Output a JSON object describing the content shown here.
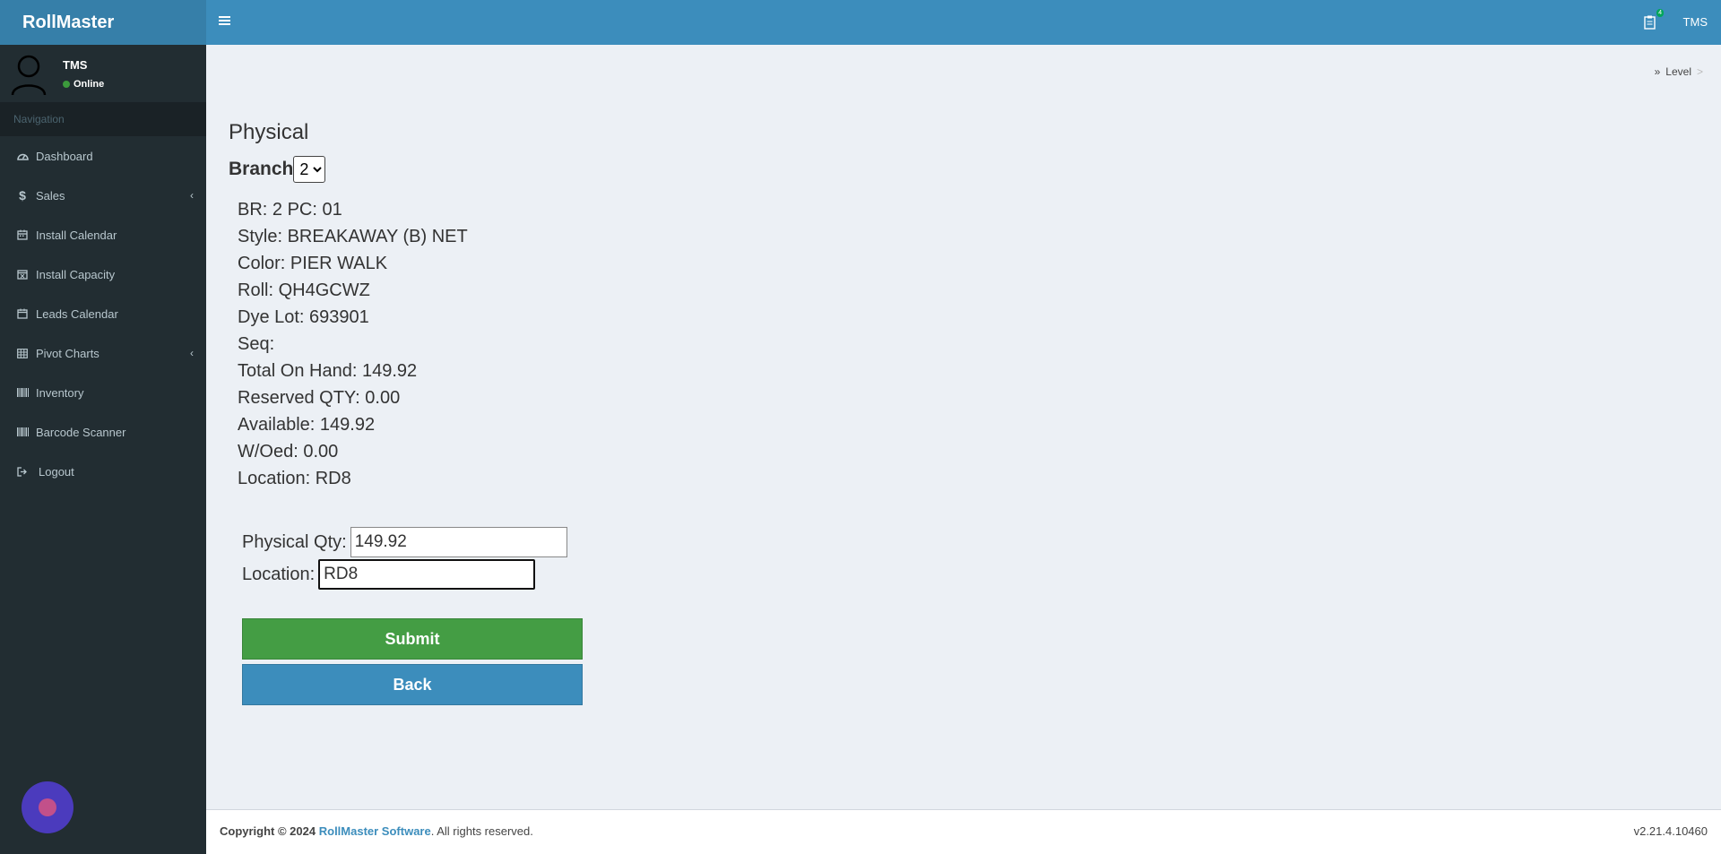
{
  "app": {
    "title": "RollMaster"
  },
  "user": {
    "name": "TMS",
    "status": "Online"
  },
  "nav": {
    "header": "Navigation",
    "items": [
      {
        "label": "Dashboard",
        "icon": "dashboard-icon"
      },
      {
        "label": "Sales",
        "icon": "dollar-icon"
      },
      {
        "label": "Install Calendar",
        "icon": "calendar-icon"
      },
      {
        "label": "Install Capacity",
        "icon": "calendar-x-icon"
      },
      {
        "label": "Leads Calendar",
        "icon": "calendar-icon"
      },
      {
        "label": "Pivot Charts",
        "icon": "table-icon"
      },
      {
        "label": "Inventory",
        "icon": "barcode-icon"
      },
      {
        "label": "Barcode Scanner",
        "icon": "barcode-icon"
      },
      {
        "label": "Logout",
        "icon": "sign-out-icon"
      }
    ]
  },
  "header": {
    "user": "TMS",
    "notification_count": "4"
  },
  "breadcrumb": {
    "item": "Level",
    "separator": ">"
  },
  "page": {
    "title": "Physical",
    "branch_label": "Branch",
    "branch_value": "2"
  },
  "details": [
    "BR: 2 PC: 01",
    "Style: BREAKAWAY (B) NET",
    "Color: PIER WALK",
    "Roll: QH4GCWZ",
    "Dye Lot: 693901",
    "Seq:",
    "Total On Hand: 149.92",
    "Reserved QTY: 0.00",
    "Available: 149.92",
    "W/Oed: 0.00",
    "Location: RD8"
  ],
  "form": {
    "qty_label": "Physical Qty:",
    "qty_value": "149.92",
    "location_label": "Location:",
    "location_value": "RD8",
    "submit_label": "Submit",
    "back_label": "Back"
  },
  "footer": {
    "copyright_prefix": "Copyright © 2024",
    "brand": "RollMaster Software",
    "suffix": ". All rights reserved.",
    "version": "v2.21.4.10460"
  },
  "colors": {
    "header": "#3c8dbc",
    "logo": "#367fa9",
    "sidebar": "#222d32",
    "submit": "#449d44",
    "back": "#3c8dbc"
  }
}
